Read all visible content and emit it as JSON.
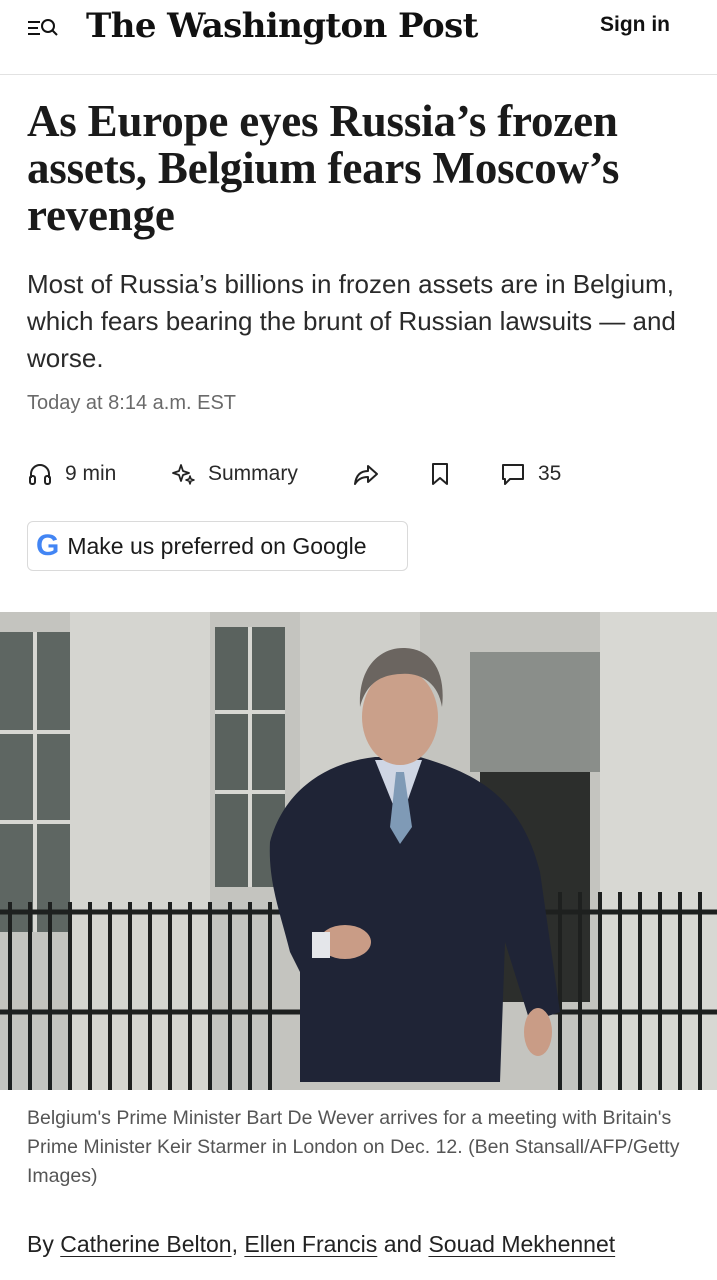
{
  "header": {
    "logo_text": "The Washington Post",
    "sign_in_label": "Sign in",
    "menu_icon": "menu-search-icon"
  },
  "article": {
    "headline": "As Europe eyes Russia’s frozen assets, Belgium fears Moscow’s revenge",
    "dek": "Most of Russia’s billions in frozen assets are in Belgium, which fears bearing the brunt of Russian lawsuits — and worse.",
    "timestamp": "Today at 8:14 a.m. EST",
    "actions": {
      "listen_label": "9 min",
      "listen_icon": "headphones-icon",
      "summary_label": "Summary",
      "summary_icon": "sparkle-icon",
      "share_icon": "share-icon",
      "bookmark_icon": "bookmark-icon",
      "comments_count": "35",
      "comments_icon": "comment-icon"
    },
    "preferred_google": {
      "label": "Make us preferred on Google",
      "icon_letter": "G"
    },
    "photo": {
      "caption": "Belgium's Prime Minister Bart De Wever arrives for a meeting with Britain's Prime Minister Keir Starmer in London on Dec. 12. (Ben Stansall/AFP/Getty Images)"
    },
    "byline": {
      "prefix": "By",
      "authors": [
        "Catherine Belton",
        "Ellen Francis",
        "Souad Mekhennet"
      ],
      "separator": ",",
      "and": "and"
    }
  },
  "colors": {
    "text": "#111111",
    "muted": "#6a6a6a",
    "divider": "#e2e2e2",
    "google_blue": "#4285f4"
  }
}
